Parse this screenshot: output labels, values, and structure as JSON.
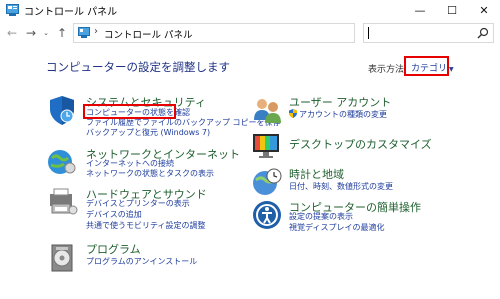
{
  "window": {
    "title": "コントロール パネル",
    "min_glyph": "—",
    "max_glyph": "☐",
    "close_glyph": "✕"
  },
  "address": {
    "separator": "›",
    "path": "コントロール パネル",
    "dropdown_glyph": "⌄",
    "refresh_glyph": "↻"
  },
  "nav": {
    "back_glyph": "←",
    "forward_glyph": "→",
    "recent_glyph": "⌄",
    "up_glyph": "↑"
  },
  "main": {
    "title": "コンピューターの設定を調整します",
    "view_by_label": "表示方法:",
    "view_by_value": "カテゴリ",
    "view_by_caret": "▼"
  },
  "categories": {
    "system": {
      "title": "システムとセキュリティ",
      "links": [
        "コンピューターの状態を確認",
        "ファイル履歴でファイルのバックアップ コピーを保存",
        "バックアップと復元 (Windows 7)"
      ]
    },
    "network": {
      "title": "ネットワークとインターネット",
      "links": [
        "インターネットへの接続",
        "ネットワークの状態とタスクの表示"
      ]
    },
    "hardware": {
      "title": "ハードウェアとサウンド",
      "links": [
        "デバイスとプリンターの表示",
        "デバイスの追加",
        "共通で使うモビリティ設定の調整"
      ]
    },
    "programs": {
      "title": "プログラム",
      "links": [
        "プログラムのアンインストール"
      ]
    },
    "accounts": {
      "title": "ユーザー アカウント",
      "links": [
        "アカウントの種類の変更"
      ]
    },
    "appearance": {
      "title": "デスクトップのカスタマイズ",
      "links": []
    },
    "clock": {
      "title": "時計と地域",
      "links": [
        "日付、時刻、数値形式の変更"
      ]
    },
    "ease": {
      "title": "コンピューターの簡単操作",
      "links": [
        "設定の提案の表示",
        "視覚ディスプレイの最適化"
      ]
    }
  },
  "colors": {
    "accent_red": "#e60000",
    "link_blue": "#1e3c9c",
    "title_green": "#1e5f2e",
    "heading_blue": "#1e3287"
  }
}
